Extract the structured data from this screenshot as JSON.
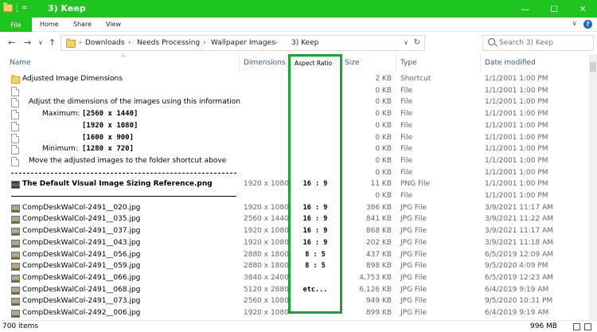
{
  "window": {
    "title": "3) Keep",
    "qat_label": "=",
    "controls": {
      "minimize": "—",
      "maximize": "☐",
      "close": "✕"
    }
  },
  "ribbon": {
    "tabs": [
      "File",
      "Home",
      "Share",
      "View"
    ],
    "collapse": "∨",
    "help": "?"
  },
  "nav": {
    "back": "←",
    "forward": "→",
    "recent": "∨",
    "up": "↑",
    "breadcrumb": [
      "Downloads",
      "Needs Processing",
      "Wallpaper Images",
      "3) Keep"
    ],
    "sep": "›",
    "dropdown": "∨",
    "refresh": "↻",
    "search_placeholder": "Search   3) Keep"
  },
  "columns": {
    "name": "Name",
    "dimensions": "Dimensions",
    "aspect_ratio": "Aspect Ratio",
    "size": "Size",
    "type": "Type",
    "date": "Date modified"
  },
  "rows": [
    {
      "icon": "folder",
      "name": "Adjusted Image Dimensions",
      "dim": "",
      "ratio": "",
      "size": "2 KB",
      "type": "Shortcut",
      "date": "1/1/2001 1:00 PM"
    },
    {
      "icon": "doc",
      "name": "",
      "dim": "",
      "ratio": "",
      "size": "0 KB",
      "type": "File",
      "date": "1/1/2001 1:00 PM"
    },
    {
      "icon": "doc",
      "name": "Adjust the dimensions of the images using this information",
      "dim": "",
      "ratio": "",
      "size": "0 KB",
      "type": "File",
      "date": "1/1/2001 1:00 PM"
    },
    {
      "icon": "doc",
      "name": "Maximum:",
      "dim_inline": "[2560 x 1440]",
      "dim": "",
      "ratio": "",
      "size": "0 KB",
      "type": "File",
      "date": "1/1/2001 1:00 PM"
    },
    {
      "icon": "doc",
      "name": "",
      "dim_inline": "[1920 x 1080]",
      "dim": "",
      "ratio": "",
      "size": "0 KB",
      "type": "File",
      "date": "1/1/2001 1:00 PM"
    },
    {
      "icon": "doc",
      "name": "",
      "dim_inline": "[1600 x  900]",
      "dim": "",
      "ratio": "",
      "size": "0 KB",
      "type": "File",
      "date": "1/1/2001 1:00 PM"
    },
    {
      "icon": "doc",
      "name": "Minimum:",
      "dim_inline": "[1280 x  720]",
      "dim": "",
      "ratio": "",
      "size": "0 KB",
      "type": "File",
      "date": "1/1/2001 1:00 PM"
    },
    {
      "icon": "doc",
      "name": "Move the adjusted images to the folder shortcut above",
      "dim": "",
      "ratio": "",
      "size": "0 KB",
      "type": "File",
      "date": "1/1/2001 1:00 PM"
    },
    {
      "icon": "dash",
      "name": "",
      "dim": "",
      "ratio": "",
      "size": "0 KB",
      "type": "File",
      "date": "1/1/2001 1:00 PM"
    },
    {
      "icon": "img-dark",
      "name": "The Default Visual Image Sizing Reference.png",
      "dim": "1920 x 1080",
      "ratio": "16 : 9",
      "size": "11 KB",
      "type": "PNG File",
      "date": "1/1/2001 1:00 PM"
    },
    {
      "icon": "solid",
      "name": "",
      "dim": "",
      "ratio": "",
      "size": "0 KB",
      "type": "File",
      "date": "1/1/2001 1:00 PM"
    },
    {
      "icon": "img",
      "name": "CompDeskWalCol-2491__020.jpg",
      "dim": "1920 x 1080",
      "ratio": "16 : 9",
      "size": "386 KB",
      "type": "JPG File",
      "date": "3/9/2021 11:17 AM"
    },
    {
      "icon": "img",
      "name": "CompDeskWalCol-2491__035.jpg",
      "dim": "2560 x 1440",
      "ratio": "16 : 9",
      "size": "841 KB",
      "type": "JPG File",
      "date": "3/9/2021 11:22 AM"
    },
    {
      "icon": "img",
      "name": "CompDeskWalCol-2491__037.jpg",
      "dim": "1920 x 1080",
      "ratio": "16 : 9",
      "size": "868 KB",
      "type": "JPG File",
      "date": "3/9/2021 11:17 AM"
    },
    {
      "icon": "img",
      "name": "CompDeskWalCol-2491__043.jpg",
      "dim": "1920 x 1080",
      "ratio": "16 : 9",
      "size": "202 KB",
      "type": "JPG File",
      "date": "3/9/2021 11:18 AM"
    },
    {
      "icon": "img",
      "name": "CompDeskWalCol-2491__056.jpg",
      "dim": "2880 x 1800",
      "ratio": "8 : 5",
      "size": "437 KB",
      "type": "JPG File",
      "date": "6/5/2019 12:09 AM"
    },
    {
      "icon": "img",
      "name": "CompDeskWalCol-2491__059.jpg",
      "dim": "2880 x 1800",
      "ratio": "8 : 5",
      "size": "898 KB",
      "type": "JPG File",
      "date": "9/5/2020 4:09 PM"
    },
    {
      "icon": "img",
      "name": "CompDeskWalCol-2491__066.jpg",
      "dim": "3840 x 2400",
      "ratio": "",
      "size": "4,753 KB",
      "type": "JPG File",
      "date": "6/5/2019 12:23 AM"
    },
    {
      "icon": "img",
      "name": "CompDeskWalCol-2491__068.jpg",
      "dim": "5120 x 2880",
      "ratio": "etc...",
      "size": "6,126 KB",
      "type": "JPG File",
      "date": "6/4/2019 9:19 AM"
    },
    {
      "icon": "img",
      "name": "CompDeskWalCol-2491__073.jpg",
      "dim": "2560 x 1080",
      "ratio": "",
      "size": "949 KB",
      "type": "JPG File",
      "date": "9/5/2020 10:31 PM"
    },
    {
      "icon": "img",
      "name": "CompDeskWalCol-2492__006.jpg",
      "dim": "1920 x 1080",
      "ratio": "",
      "size": "899 KB",
      "type": "JPG File",
      "date": "6/4/2019 9:19 AM"
    }
  ],
  "status": {
    "count": "700 items",
    "size": "996 MB"
  },
  "colors": {
    "accent": "#1ec51e",
    "highlight_box": "#1aa33a",
    "header_text": "#3c5a8a"
  }
}
